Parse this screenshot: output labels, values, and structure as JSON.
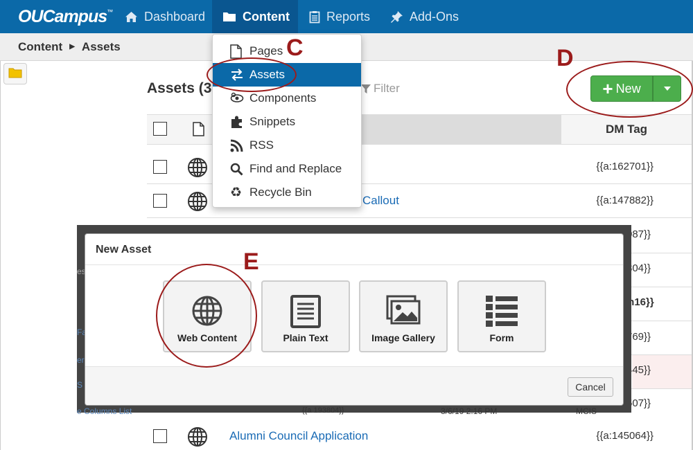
{
  "app": {
    "logo_text": "OUCampus",
    "logo_tm": "™"
  },
  "nav": {
    "items": [
      {
        "label": "Dashboard",
        "icon": "home-icon"
      },
      {
        "label": "Content",
        "icon": "folder-icon",
        "active": true
      },
      {
        "label": "Reports",
        "icon": "clipboard-icon"
      },
      {
        "label": "Add-Ons",
        "icon": "pin-icon"
      }
    ]
  },
  "breadcrumb": {
    "items": [
      "Content",
      "Assets"
    ]
  },
  "content_menu": {
    "items": [
      {
        "label": "Pages",
        "icon": "page-icon"
      },
      {
        "label": "Assets",
        "icon": "swap-arrows-icon",
        "active": true
      },
      {
        "label": "Components",
        "icon": "eye-icon"
      },
      {
        "label": "Snippets",
        "icon": "puzzle-icon"
      },
      {
        "label": "RSS",
        "icon": "rss-icon"
      },
      {
        "label": "Find and Replace",
        "icon": "search-icon"
      },
      {
        "label": "Recycle Bin",
        "icon": "recycle-icon"
      }
    ]
  },
  "assets": {
    "title": "Assets (3",
    "filter_placeholder": "Filter",
    "new_label": "New",
    "table": {
      "columns": [
        "DM Tag"
      ],
      "rows": [
        {
          "title": "",
          "dm_tag": "{{a:162701}}"
        },
        {
          "title": "Callout",
          "dm_tag": "{{a:147882}}"
        },
        {
          "title": "Alumni Council Application",
          "dm_tag": "{{a:145064}}"
        }
      ],
      "peek_tags": [
        "087}}",
        "804}}",
        "on16}}",
        "769}}",
        "445}}",
        "507}}"
      ],
      "peek_mid": [
        "{{a 193804}}",
        "3/6/19 2:16 PM",
        "MCIS"
      ],
      "peek_left": [
        "es",
        "Fa",
        "er",
        "S",
        "e Columns List"
      ]
    }
  },
  "modal": {
    "title": "New Asset",
    "tiles": [
      {
        "label": "Web Content",
        "icon": "globe-icon"
      },
      {
        "label": "Plain Text",
        "icon": "text-document-icon"
      },
      {
        "label": "Image Gallery",
        "icon": "image-gallery-icon"
      },
      {
        "label": "Form",
        "icon": "list-form-icon"
      }
    ],
    "cancel_label": "Cancel"
  },
  "annotations": {
    "c": "C",
    "d": "D",
    "e": "E",
    "color": "#9b1b1b"
  },
  "colors": {
    "nav_bg": "#0b69a8",
    "new_button": "#4cae4c",
    "link": "#1a6bb5"
  }
}
